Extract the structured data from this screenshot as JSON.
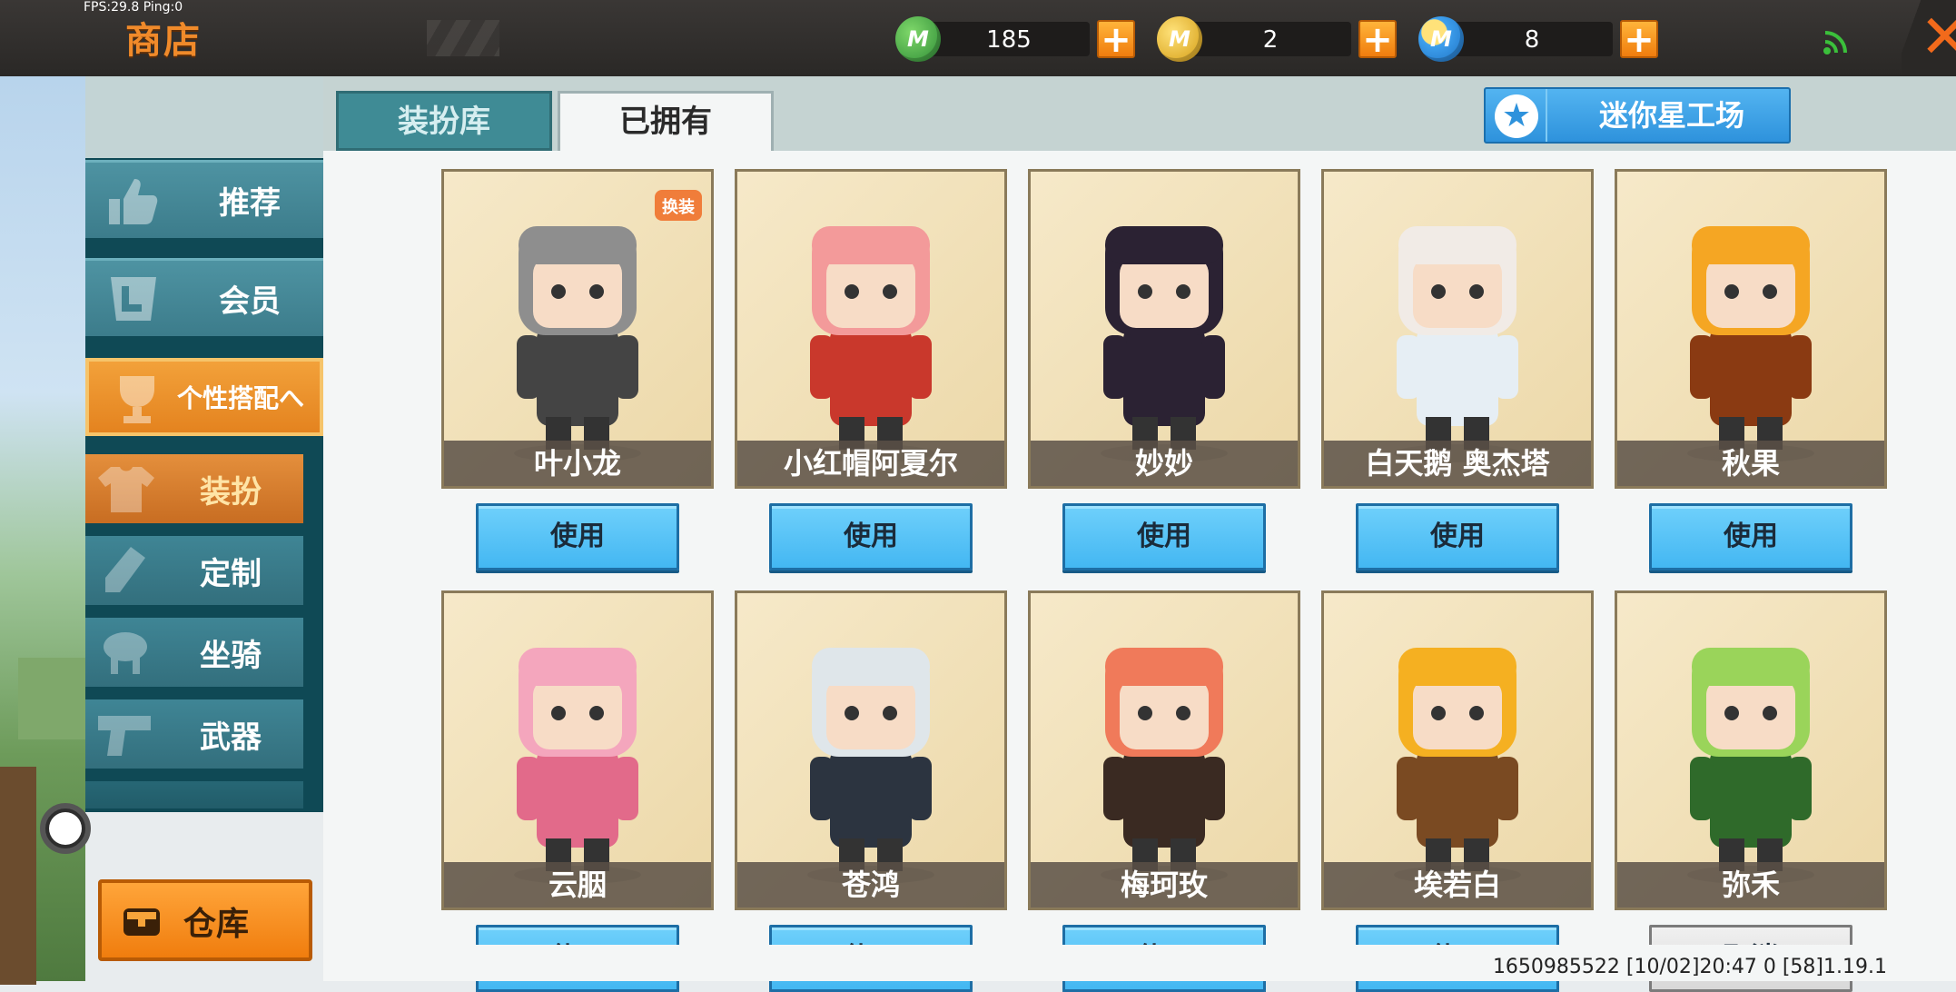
{
  "status": {
    "fps": "FPS:29.8  Ping:0"
  },
  "header": {
    "title": "商店"
  },
  "currencies": [
    {
      "icon": "green-mini-coin-icon",
      "letter": "M",
      "value": "185",
      "color": "#3aa34a"
    },
    {
      "icon": "gold-mini-coin-icon",
      "letter": "M",
      "value": "2",
      "color": "#e9b21c"
    },
    {
      "icon": "blue-mini-bean-icon",
      "letter": "M",
      "value": "8",
      "color": "#2b8fe0"
    }
  ],
  "plus_label": "+",
  "close_label": "✕",
  "sidebar": {
    "items": [
      {
        "label": "推荐"
      },
      {
        "label": "会员"
      },
      {
        "label": "个性搭配へ"
      }
    ],
    "sub_items": [
      {
        "label": "装扮"
      },
      {
        "label": "定制"
      },
      {
        "label": "坐骑"
      },
      {
        "label": "武器"
      }
    ],
    "warehouse": "仓库"
  },
  "tabs": [
    {
      "label": "装扮库"
    },
    {
      "label": "已拥有"
    }
  ],
  "workshop": {
    "label": "迷你星工场",
    "icon": "★"
  },
  "skins": [
    {
      "name": "叶小龙",
      "action": "使用",
      "hair": "#8e8e8e",
      "outfit": "#444",
      "badge": "换装"
    },
    {
      "name": "小红帽阿夏尔",
      "action": "使用",
      "hair": "#f39a9a",
      "outfit": "#c9382c"
    },
    {
      "name": "妙妙",
      "action": "使用",
      "hair": "#2b2233",
      "outfit": "#2b2233"
    },
    {
      "name": "白天鹅 奥杰塔",
      "action": "使用",
      "hair": "#f1ebe6",
      "outfit": "#e6eef4"
    },
    {
      "name": "秋果",
      "action": "使用",
      "hair": "#f5a623",
      "outfit": "#8a3a12"
    },
    {
      "name": "云胭",
      "action": "使用",
      "hair": "#f4a6bd",
      "outfit": "#e26a8a"
    },
    {
      "name": "苍鸿",
      "action": "使用",
      "hair": "#dfe6ea",
      "outfit": "#2c3440"
    },
    {
      "name": "梅珂玫",
      "action": "使用",
      "hair": "#f07a5a",
      "outfit": "#3a2a22"
    },
    {
      "name": "埃若白",
      "action": "使用",
      "hair": "#f5b021",
      "outfit": "#7a4a22"
    },
    {
      "name": "弥禾",
      "action": "取消",
      "hair": "#9ad45a",
      "outfit": "#2f6a2a"
    }
  ],
  "footer": "1650985522  [10/02]20:47 0  [58]1.19.1"
}
